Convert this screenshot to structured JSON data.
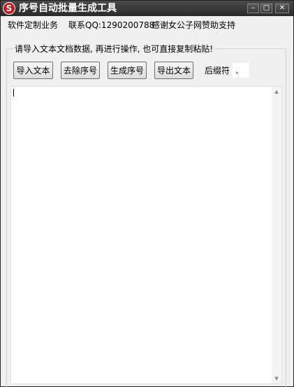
{
  "window": {
    "title": "序号自动批量生成工具",
    "icon_letter": "S",
    "controls": {
      "minimize": "–",
      "maximize": "□",
      "close": "✕"
    }
  },
  "info": {
    "custom_software": "软件定制业务",
    "contact": "联系QQ:1290200788",
    "thanks": "感谢女公子网赞助支持"
  },
  "group": {
    "legend": "请导入文本文档数据, 再进行操作, 也可直接复制粘贴!"
  },
  "toolbar": {
    "import_label": "导入文本",
    "remove_label": "去除序号",
    "generate_label": "生成序号",
    "export_label": "导出文本",
    "suffix_label": "后缀符",
    "suffix_value": "、"
  },
  "editor": {
    "content": "",
    "scroll_up": "▲",
    "scroll_down": "▼"
  }
}
